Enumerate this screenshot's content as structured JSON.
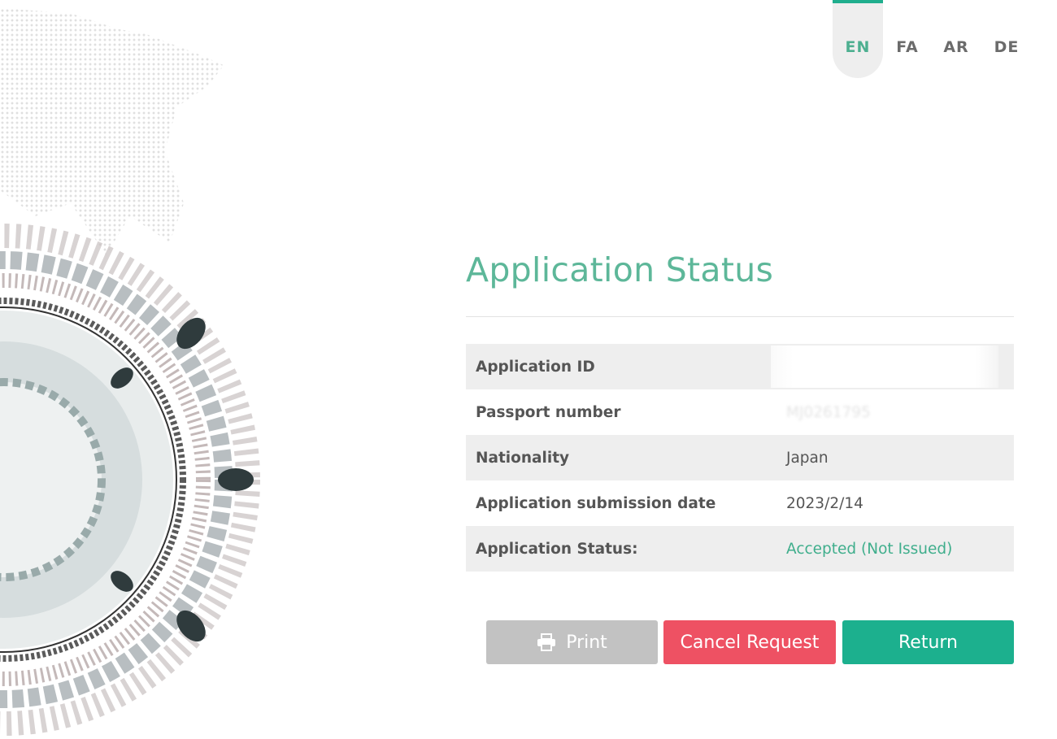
{
  "languages": [
    {
      "code": "EN",
      "active": true
    },
    {
      "code": "FA"
    },
    {
      "code": "AR"
    },
    {
      "code": "DE"
    }
  ],
  "page_title": "Application Status",
  "rows": [
    {
      "label": "Application ID",
      "value": ""
    },
    {
      "label": "Passport number",
      "value": "MJ0261795"
    },
    {
      "label": "Nationality",
      "value": "Japan"
    },
    {
      "label": "Application submission date",
      "value": "2023/2/14"
    },
    {
      "label": "Application Status:",
      "value": "Accepted (Not Issued)"
    }
  ],
  "buttons": {
    "print": "Print",
    "cancel": "Cancel Request",
    "return": "Return"
  },
  "colors": {
    "accent": "#1cb08e",
    "title": "#5db799",
    "danger": "#ee5163",
    "disabled": "#c2c2c2"
  }
}
